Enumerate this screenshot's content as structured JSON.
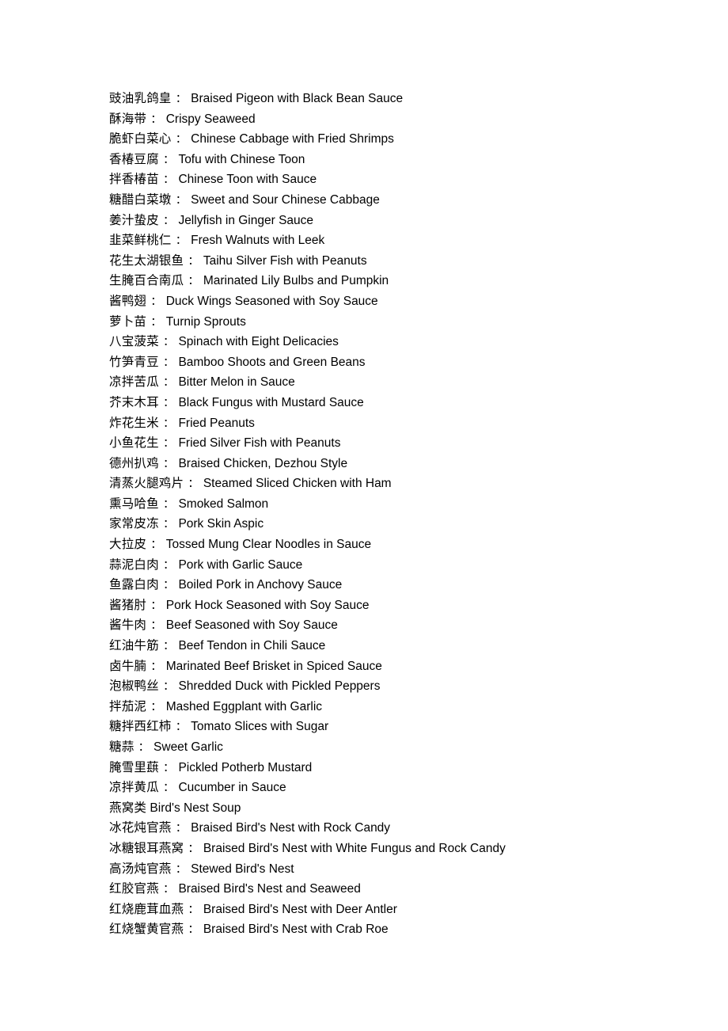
{
  "page": {
    "background_color": "#ffffff",
    "text_color": "#000000",
    "separator": "：",
    "section_title": "燕窝类 Bird's Nest Soup"
  },
  "menu": {
    "entries": [
      {
        "cn": "豉油乳鸽皇",
        "sep": "：",
        "en": "Braised Pigeon with Black Bean Sauce",
        "is_section": false
      },
      {
        "cn": "酥海带",
        "sep": "：",
        "en": "Crispy Seaweed",
        "is_section": false
      },
      {
        "cn": "脆虾白菜心",
        "sep": "：",
        "en": "Chinese Cabbage with Fried Shrimps",
        "is_section": false
      },
      {
        "cn": "香椿豆腐",
        "sep": "：",
        "en": "Tofu with Chinese Toon",
        "is_section": false
      },
      {
        "cn": "拌香椿苗",
        "sep": "：",
        "en": "Chinese Toon with Sauce",
        "is_section": false
      },
      {
        "cn": "糖醋白菜墩",
        "sep": "：",
        "en": "Sweet and Sour Chinese Cabbage",
        "is_section": false
      },
      {
        "cn": "姜汁蛰皮",
        "sep": "：",
        "en": "Jellyfish in Ginger Sauce",
        "is_section": false
      },
      {
        "cn": "韭菜鲜桃仁",
        "sep": "：",
        "en": "Fresh Walnuts with Leek",
        "is_section": false
      },
      {
        "cn": "花生太湖银鱼",
        "sep": "：",
        "en": "Taihu Silver Fish with Peanuts",
        "is_section": false
      },
      {
        "cn": "生腌百合南瓜",
        "sep": "：",
        "en": "Marinated Lily Bulbs and Pumpkin",
        "is_section": false
      },
      {
        "cn": "酱鸭翅",
        "sep": "：",
        "en": "Duck Wings Seasoned with Soy Sauce",
        "is_section": false
      },
      {
        "cn": "萝卜苗",
        "sep": "：",
        "en": "Turnip Sprouts",
        "is_section": false
      },
      {
        "cn": "八宝菠菜",
        "sep": "：",
        "en": "Spinach with Eight Delicacies",
        "is_section": false
      },
      {
        "cn": "竹笋青豆",
        "sep": "：",
        "en": "Bamboo Shoots and Green Beans",
        "is_section": false
      },
      {
        "cn": "凉拌苦瓜",
        "sep": "：",
        "en": "Bitter Melon in Sauce",
        "is_section": false
      },
      {
        "cn": "芥末木耳",
        "sep": "：",
        "en": "Black Fungus with Mustard Sauce",
        "is_section": false
      },
      {
        "cn": "炸花生米",
        "sep": "：",
        "en": "Fried Peanuts",
        "is_section": false
      },
      {
        "cn": "小鱼花生",
        "sep": "：",
        "en": "Fried Silver Fish with Peanuts",
        "is_section": false
      },
      {
        "cn": "德州扒鸡",
        "sep": "：",
        "en": "Braised Chicken, Dezhou Style",
        "is_section": false
      },
      {
        "cn": "清蒸火腿鸡片",
        "sep": "：",
        "en": "Steamed Sliced Chicken with Ham",
        "is_section": false
      },
      {
        "cn": "熏马哈鱼",
        "sep": "：",
        "en": "Smoked Salmon",
        "is_section": false
      },
      {
        "cn": "家常皮冻",
        "sep": "：",
        "en": "Pork Skin Aspic",
        "is_section": false
      },
      {
        "cn": "大拉皮",
        "sep": "：",
        "en": "Tossed Mung Clear Noodles in Sauce",
        "is_section": false
      },
      {
        "cn": "蒜泥白肉",
        "sep": "：",
        "en": "Pork with Garlic Sauce",
        "is_section": false
      },
      {
        "cn": "鱼露白肉",
        "sep": "：",
        "en": "Boiled Pork in Anchovy Sauce",
        "is_section": false
      },
      {
        "cn": "酱猪肘",
        "sep": "：",
        "en": "Pork Hock Seasoned with Soy Sauce",
        "is_section": false
      },
      {
        "cn": "酱牛肉",
        "sep": "：",
        "en": "Beef Seasoned with Soy Sauce",
        "is_section": false
      },
      {
        "cn": "红油牛筋",
        "sep": "：",
        "en": "Beef Tendon in Chili Sauce",
        "is_section": false
      },
      {
        "cn": "卤牛腩",
        "sep": "：",
        "en": "Marinated Beef Brisket in Spiced Sauce",
        "is_section": false
      },
      {
        "cn": "泡椒鸭丝",
        "sep": "：",
        "en": "Shredded Duck with Pickled Peppers",
        "is_section": false
      },
      {
        "cn": "拌茄泥",
        "sep": "：",
        "en": "Mashed Eggplant with Garlic",
        "is_section": false
      },
      {
        "cn": "糖拌西红柿",
        "sep": "：",
        "en": "Tomato Slices with Sugar",
        "is_section": false
      },
      {
        "cn": "糖蒜",
        "sep": "：",
        "en": "Sweet Garlic",
        "is_section": false
      },
      {
        "cn": "腌雪里蕻",
        "sep": "：",
        "en": "Pickled Potherb Mustard",
        "is_section": false
      },
      {
        "cn": "凉拌黄瓜",
        "sep": "：",
        "en": "Cucumber in Sauce",
        "is_section": false
      },
      {
        "cn": "燕窝类",
        "sep": "",
        "en": "Bird's Nest Soup",
        "is_section": true
      },
      {
        "cn": "冰花炖官燕",
        "sep": "：",
        "en": "Braised Bird's Nest with Rock Candy",
        "is_section": false
      },
      {
        "cn": "冰糖银耳燕窝",
        "sep": "：",
        "en": "Braised Bird's Nest with White Fungus and Rock Candy",
        "is_section": false
      },
      {
        "cn": "高汤炖官燕",
        "sep": "：",
        "en": "Stewed Bird's Nest",
        "is_section": false
      },
      {
        "cn": "红胶官燕",
        "sep": "：",
        "en": "Braised Bird's Nest and Seaweed",
        "is_section": false
      },
      {
        "cn": "红烧鹿茸血燕",
        "sep": "：",
        "en": "Braised Bird's Nest with Deer Antler",
        "is_section": false
      },
      {
        "cn": "红烧蟹黄官燕",
        "sep": "：",
        "en": "Braised Bird's Nest with Crab Roe",
        "is_section": false
      }
    ]
  }
}
